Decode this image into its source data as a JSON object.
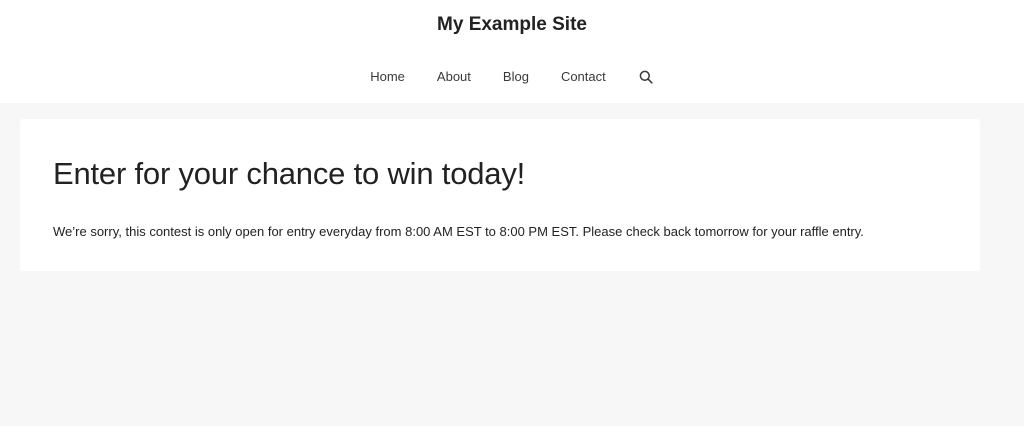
{
  "header": {
    "site_title": "My Example Site",
    "nav": {
      "items": [
        {
          "label": "Home"
        },
        {
          "label": "About"
        },
        {
          "label": "Blog"
        },
        {
          "label": "Contact"
        }
      ],
      "search_icon": "search-icon"
    }
  },
  "main": {
    "title": "Enter for your chance to win today!",
    "message": "We’re sorry, this contest is only open for entry everyday from 8:00 AM EST to 8:00 PM EST. Please check back tomorrow for your raffle entry."
  },
  "colors": {
    "page_background": "#f7f7f7",
    "card_background": "#ffffff",
    "text": "#222222",
    "nav_text": "#3a3a3a"
  }
}
